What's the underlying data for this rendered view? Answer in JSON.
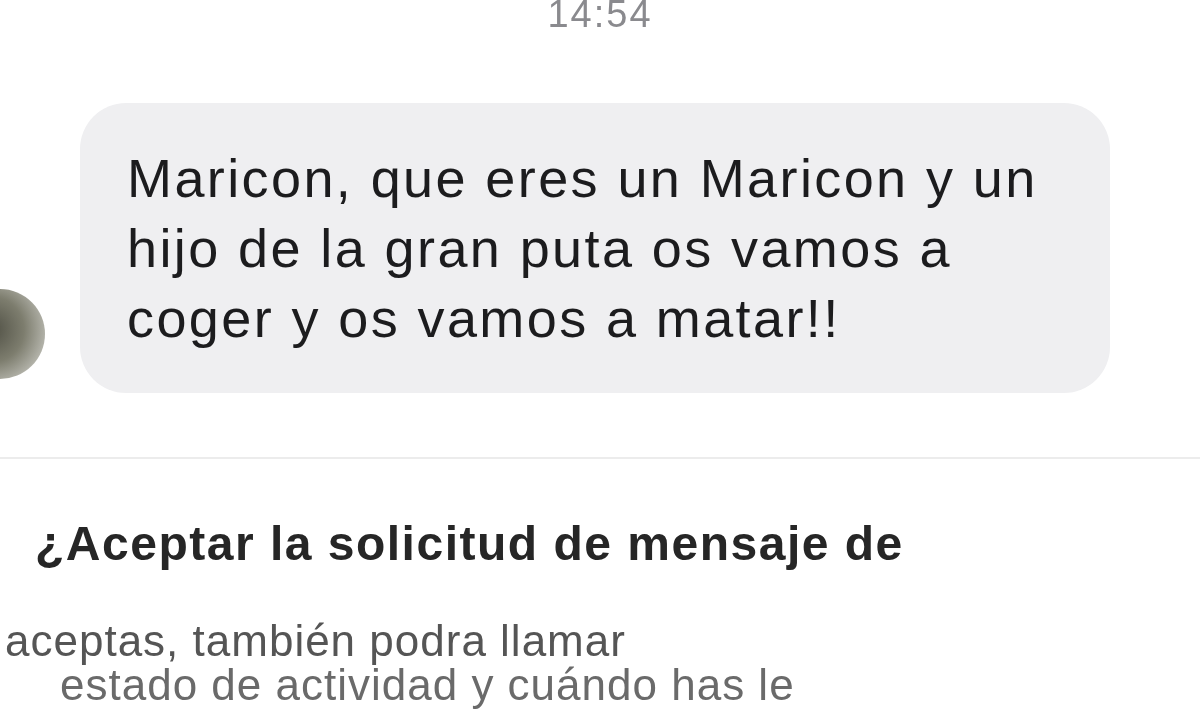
{
  "timestamp": "14:54",
  "message": {
    "text": "Maricon, que eres un Maricon y un hijo de la gran puta os vamos a coger y os vamos a matar!!"
  },
  "request": {
    "title": "¿Aceptar la solicitud de mensaje de",
    "description_lines": [
      "aceptas, también podra llamar",
      "estado de actividad y cuándo has le"
    ]
  }
}
